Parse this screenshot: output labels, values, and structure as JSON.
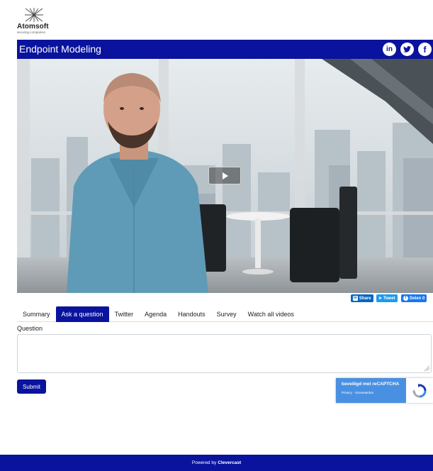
{
  "brand": {
    "name": "Atomsoft",
    "tagline": "securing companies"
  },
  "header": {
    "title": "Endpoint Modeling",
    "social": [
      {
        "icon": "linkedin-icon",
        "glyph": "in"
      },
      {
        "icon": "twitter-icon",
        "glyph": "🐦"
      },
      {
        "icon": "facebook-icon",
        "glyph": "f"
      }
    ]
  },
  "video": {
    "play_icon": "play-icon"
  },
  "share": {
    "linkedin_label": "Share",
    "linkedin_glyph": "in",
    "twitter_label": "Tweet",
    "facebook_label": "Delen 0"
  },
  "tabs": [
    {
      "label": "Summary",
      "active": false
    },
    {
      "label": "Ask a question",
      "active": true
    },
    {
      "label": "Twitter",
      "active": false
    },
    {
      "label": "Agenda",
      "active": false
    },
    {
      "label": "Handouts",
      "active": false
    },
    {
      "label": "Survey",
      "active": false
    },
    {
      "label": "Watch all videos",
      "active": false
    }
  ],
  "form": {
    "question_label": "Question",
    "question_value": "",
    "submit_label": "Submit"
  },
  "recaptcha": {
    "title": "beveiligd met reCAPTCHA",
    "links": "Privacy · Voorwaarden"
  },
  "footer": {
    "prefix": "Powered by",
    "brand": "Clevercast"
  },
  "colors": {
    "primary": "#0a139d",
    "linkedin": "#0a66c2",
    "twitter": "#1d9bf0",
    "facebook": "#1877f2",
    "recaptcha": "#4a90e2"
  }
}
